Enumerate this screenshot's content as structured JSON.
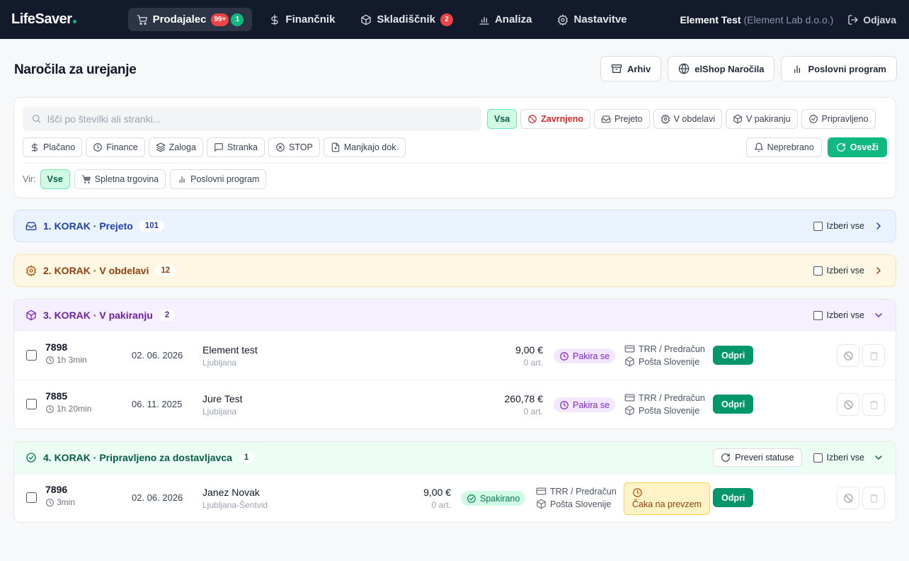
{
  "nav": {
    "logo": "LifeSaver",
    "items": [
      {
        "label": "Prodajalec",
        "badge_red": "99+",
        "badge_green": "1",
        "active": true
      },
      {
        "label": "Finančnik"
      },
      {
        "label": "Skladiščnik",
        "badge_red": "2"
      },
      {
        "label": "Analiza"
      },
      {
        "label": "Nastavitve"
      }
    ],
    "user": "Element Test",
    "company": "(Element Lab d.o.o.)",
    "logout": "Odjava"
  },
  "header": {
    "title": "Naročila za urejanje",
    "actions": [
      "Arhiv",
      "elShop Naročila",
      "Poslovni program"
    ]
  },
  "filters": {
    "search_placeholder": "Išči po številki ali stranki...",
    "status_chips": [
      "Vsa",
      "Zavrnjeno",
      "Prejeto",
      "V obdelavi",
      "V pakiranju",
      "Pripravljeno"
    ],
    "flag_chips": [
      "Plačano",
      "Finance",
      "Zaloga",
      "Stranka",
      "STOP",
      "Manjkajo dok."
    ],
    "unread": "Neprebrano",
    "refresh": "Osveži",
    "source_label": "Vir:",
    "source_chips": [
      "Vse",
      "Spletna trgovina",
      "Poslovni program"
    ]
  },
  "sections": [
    {
      "title": "1. KORAK · Prejeto",
      "count": "101",
      "select_all": "Izberi vse"
    },
    {
      "title": "2. KORAK · V obdelavi",
      "count": "12",
      "select_all": "Izberi vse"
    },
    {
      "title": "3. KORAK · V pakiranju",
      "count": "2",
      "select_all": "Izberi vse",
      "orders": [
        {
          "number": "7898",
          "elapsed": "1h 3min",
          "date": "02. 06. 2026",
          "customer": "Element test",
          "city": "Ljubljana",
          "price": "9,00 €",
          "articles": "0 art.",
          "status": "Pakira se",
          "payment": "TRR / Predračun",
          "shipping": "Pošta Slovenije",
          "open": "Odpri"
        },
        {
          "number": "7885",
          "elapsed": "1h 20min",
          "date": "06. 11. 2025",
          "customer": "Jure Test",
          "city": "Ljubljana",
          "price": "260,78 €",
          "articles": "0 art.",
          "status": "Pakira se",
          "payment": "TRR / Predračun",
          "shipping": "Pošta Slovenije",
          "open": "Odpri"
        }
      ]
    },
    {
      "title": "4. KORAK · Pripravljeno za dostavljavca",
      "count": "1",
      "select_all": "Izberi vse",
      "check_status": "Preveri statuse",
      "orders": [
        {
          "number": "7896",
          "elapsed": "3min",
          "date": "02. 06. 2026",
          "customer": "Janez Novak",
          "city": "Ljubljana-Šentvid",
          "price": "9,00 €",
          "articles": "0 art.",
          "status": "Spakirano",
          "payment": "TRR / Predračun",
          "shipping": "Pošta Slovenije",
          "waiting": "Čaka na prevzem",
          "open": "Odpri"
        }
      ]
    }
  ],
  "colors": {
    "nav_bg": "#131a2c",
    "accent": "#10b981",
    "danger": "#ef4444"
  }
}
